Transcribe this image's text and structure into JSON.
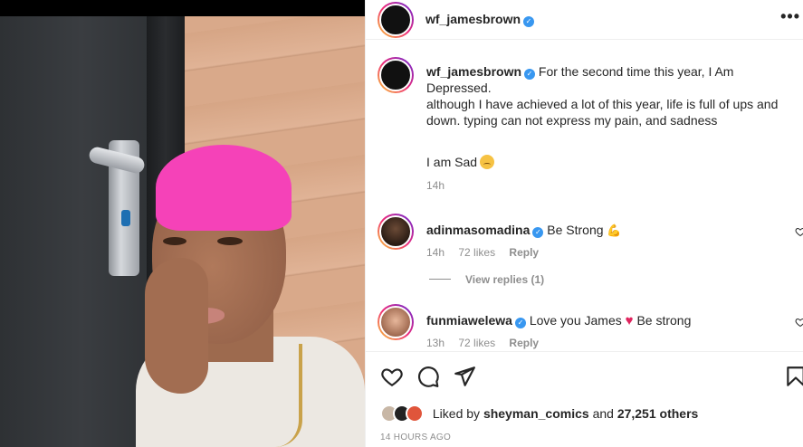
{
  "post": {
    "username": "wf_jamesbrown",
    "more_label": "•••"
  },
  "caption": {
    "username": "wf_jamesbrown",
    "line1": "For the second time this year, I Am Depressed.",
    "line2": "although I have achieved a lot of this year, life is full of ups and down. typing can not express my pain, and sadness",
    "line3": "I am Sad",
    "time": "14h"
  },
  "comments": [
    {
      "username": "adinmasomadina",
      "text": "Be Strong",
      "time": "14h",
      "likes": "72 likes",
      "reply": "Reply"
    },
    {
      "username": "funmiawelewa",
      "text_before": "Love you James",
      "text_after": "Be strong",
      "time": "13h",
      "likes": "72 likes",
      "reply": "Reply"
    }
  ],
  "view_replies": "View replies (1)",
  "likes": {
    "prefix": "Liked by",
    "user": "sheyman_comics",
    "middle": "and",
    "others": "27,251 others"
  },
  "posted_ago": "14 HOURS AGO",
  "icons": {
    "verified": "verified-badge-icon",
    "like": "heart-icon",
    "comment": "comment-icon",
    "share": "paper-plane-icon",
    "save": "bookmark-icon"
  },
  "colors": {
    "verified": "#3897f0",
    "heart": "#e0245e",
    "hair": "#f542b8"
  }
}
